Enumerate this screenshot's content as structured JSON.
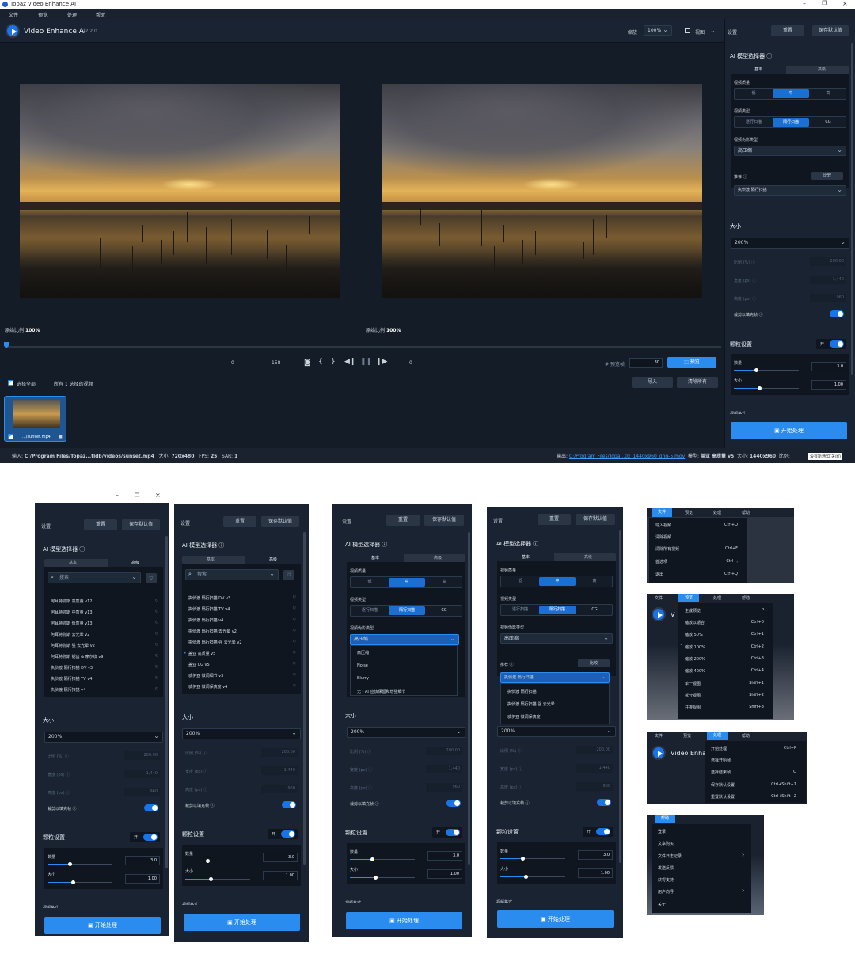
{
  "window": {
    "title": "Topaz Video Enhance AI",
    "menu": [
      "文件",
      "预览",
      "处理",
      "帮助"
    ],
    "app_name": "Video Enhance AI",
    "version": "v2.2.0",
    "zoom_label": "缩放",
    "zoom_value": "100%",
    "view_label": "视图",
    "settings_label": "设置",
    "reset_label": "重置",
    "save_default_label": "保存默认值",
    "preview_left_label": "原始比例",
    "preview_left_value": "100%",
    "preview_right_label": "原始比例",
    "preview_right_value": "100%",
    "timeline": {
      "start": "0",
      "frame": "158",
      "end": "0",
      "preview_frames_label": "# 预览帧",
      "preview_frames": "30",
      "preview_button": "预览"
    },
    "select_all": "选择全部",
    "selected_count": "所有 1 选择的视频",
    "import_label": "导入",
    "clear_all_label": "清除所有",
    "thumb_name": ".../sunset.mp4",
    "status": {
      "input_label": "输入:",
      "input_path": "C:/Program Files/Topaz...tldb/videos/sunset.mp4",
      "size_label": "大小:",
      "size": "720x480",
      "fps_label": "FPS:",
      "fps": "25",
      "sar_label": "SAR:",
      "sar": "1",
      "output_label": "输出:",
      "output_path": "C:/Program Files/Topa...0x_1440x960_ghq-5.mov",
      "model_label": "模型:",
      "model": "盖亚 高质量 v5",
      "out_size_label": "大小:",
      "out_size": "1440x960",
      "ratio_label": "比例:",
      "notice": "没有新通知(关闭)"
    }
  },
  "panel": {
    "ai_model_title": "AI 模型选择器",
    "tab_basic": "基本",
    "tab_advanced": "高级",
    "video_quality": "视频质量",
    "quality_opts": [
      "低",
      "中",
      "高"
    ],
    "video_type": "视频类型",
    "type_opts": [
      "逐行扫描",
      "隔行扫描",
      "CG"
    ],
    "artifact_type": "视频伪影类型",
    "artifact_value": "高压缩",
    "recommend": "推荐",
    "compare": "比较",
    "recommend_value": "执侦渡 隔行扫描",
    "size_title": "大小",
    "size_value": "200%",
    "ratio_label": "比例 (%)",
    "ratio_value": "200.00",
    "width_label": "宽度 (px)",
    "width_value": "1,440",
    "height_label": "高度 (px)",
    "height_value": "960",
    "crop_label": "裁剪以填充帧",
    "grain_title": "颗粒设置",
    "grain_on": "开",
    "amount_label": "数量",
    "amount_value": "3.0",
    "size_label2": "大小",
    "size_value2": "1.00",
    "output_title": "视频格式",
    "start_button": "开始处理",
    "search_placeholder": "搜索",
    "advanced_models_a": [
      "阿耳特弥斯 高质量 v12",
      "阿耳特弥斯 中质量 v13",
      "阿耳特弥斯 低质量 v13",
      "阿耳特弥斯 去光晕 v2",
      "阿耳特弥斯 强 去光晕 v2",
      "阿耳特弥斯 锯齿 & 摩尔纹 v9",
      "执侦渡 隔行扫描 DV v3",
      "执侦渡 隔行扫描 TV v4",
      "执侦渡 隔行扫描 v4"
    ],
    "advanced_models_b": [
      "执侦渡 隔行扫描 DV v3",
      "执侦渡 隔行扫描 TV v4",
      "执侦渡 隔行扫描 v4",
      "执侦渡 隔行扫描 去光晕 v2",
      "执侦渡 隔行扫描 强 去光晕 v2",
      "盖亚 高质量 v5",
      "盖亚 CG v5",
      "忒伊亚 微调细节 v3",
      "忒伊亚 微调保真度 v4"
    ],
    "artifact_opts": [
      "高压缩",
      "Noise",
      "Blurry",
      "无 - AI 应该保留和增强细节"
    ],
    "recommend_opts": [
      "执侦渡 隔行扫描",
      "执侦渡 隔行扫描 强 去光晕",
      "忒伊亚 微调保真度"
    ]
  },
  "menus": {
    "file": {
      "header": [
        "文件",
        "预览",
        "处理",
        "帮助"
      ],
      "items": [
        [
          "导入视频",
          "Ctrl+O"
        ],
        [
          "清除视频",
          ""
        ],
        [
          "清除所有视频",
          "Ctrl+F"
        ],
        [
          "首选项",
          "Ctrl+,"
        ],
        [
          "退出",
          "Ctrl+Q"
        ]
      ]
    },
    "preview": {
      "header": [
        "文件",
        "预览",
        "处理",
        "帮助"
      ],
      "items": [
        [
          "生成预览",
          "P"
        ],
        [
          "缩放以适合",
          "Ctrl+0"
        ],
        [
          "缩放 50%",
          "Ctrl+1"
        ],
        [
          "缩放 100%",
          "Ctrl+2"
        ],
        [
          "缩放 200%",
          "Ctrl+3"
        ],
        [
          "缩放 400%",
          "Ctrl+4"
        ],
        [
          "单一视图",
          "Shift+1"
        ],
        [
          "拆分视图",
          "Shift+2"
        ],
        [
          "并排视图",
          "Shift+3"
        ]
      ]
    },
    "process": {
      "header": [
        "文件",
        "预览",
        "处理",
        "帮助"
      ],
      "app_name": "Video Enha",
      "items": [
        [
          "开始处理",
          "Ctrl+P"
        ],
        [
          "选择开始帧",
          "I"
        ],
        [
          "选择结束帧",
          "O"
        ],
        [
          "保存默认设置",
          "Ctrl+Shift+1"
        ],
        [
          "重置默认设置",
          "Ctrl+Shift+2"
        ]
      ]
    },
    "help": {
      "header": "帮助",
      "items": [
        "登录",
        "文章购买",
        "文件日志记录",
        "发送反馈",
        "获得支持",
        "用户向导",
        "关于"
      ]
    }
  },
  "window_controls": [
    "–",
    "❐",
    "×"
  ]
}
